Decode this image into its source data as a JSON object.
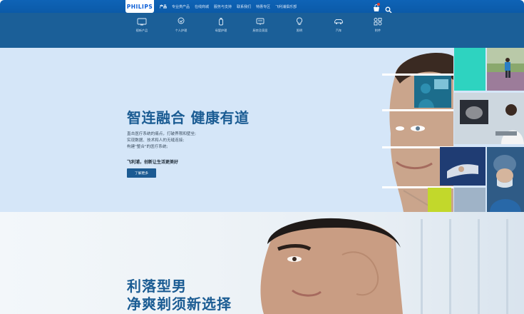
{
  "brand": {
    "logo_text": "PHILIPS"
  },
  "topnav": {
    "items": [
      {
        "label": "产品"
      },
      {
        "label": "专业类产品"
      },
      {
        "label": "在线商城"
      },
      {
        "label": "服务与支持"
      },
      {
        "label": "联系我们"
      },
      {
        "label": "特惠专区"
      },
      {
        "label": "飞利浦俱乐部"
      }
    ],
    "icons": [
      "cart-icon",
      "search-icon"
    ]
  },
  "categories": [
    {
      "icon": "tv-icon",
      "label": "视听产品"
    },
    {
      "icon": "personal-care-icon",
      "label": "个人护理"
    },
    {
      "icon": "baby-bottle-icon",
      "label": "母婴护理"
    },
    {
      "icon": "home-appliance-icon",
      "label": "厨房及家居"
    },
    {
      "icon": "lightbulb-icon",
      "label": "照明"
    },
    {
      "icon": "car-icon",
      "label": "汽车"
    },
    {
      "icon": "more-icon",
      "label": "附件"
    }
  ],
  "hero1": {
    "title": "智连融合 健康有道",
    "desc_lines": [
      "直击医疗系统的痛点，打破界限和壁垒;",
      "实现数据、技术和人的无缝连接;",
      "构建\"整合\"的医疗系统;"
    ],
    "tagline": "飞利浦，创新让生活更美好",
    "button": "了解更多"
  },
  "hero2": {
    "title_line1": "利落型男",
    "title_line2": "净爽剃须新选择"
  },
  "colors": {
    "topbar": "#0b5aa8",
    "catbar": "#1b5f98",
    "hero1_bg": "#d5e6f8",
    "accent_blue": "#1b5c93",
    "teal": "#2ed3c0",
    "lime": "#c2d82b"
  }
}
